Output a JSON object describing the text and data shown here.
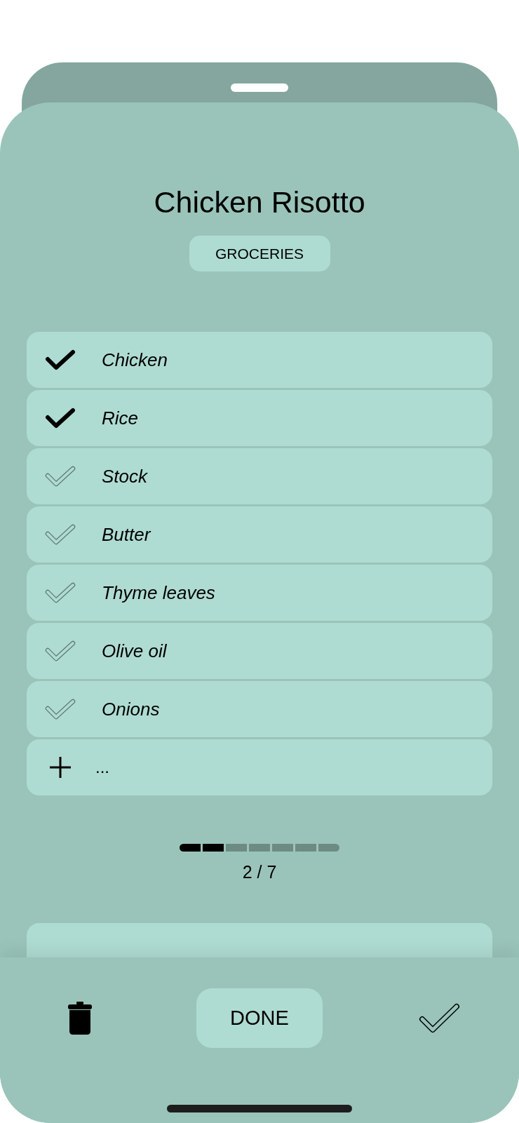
{
  "sheet": {
    "title": "Chicken Risotto",
    "category": "GROCERIES"
  },
  "items": [
    {
      "label": "Chicken",
      "checked": true
    },
    {
      "label": "Rice",
      "checked": true
    },
    {
      "label": "Stock",
      "checked": false
    },
    {
      "label": "Butter",
      "checked": false
    },
    {
      "label": "Thyme leaves",
      "checked": false
    },
    {
      "label": "Olive oil",
      "checked": false
    },
    {
      "label": "Onions",
      "checked": false
    }
  ],
  "add_item": {
    "placeholder": "..."
  },
  "progress": {
    "segments": [
      {
        "filled": true
      },
      {
        "filled": true
      },
      {
        "filled": false
      },
      {
        "filled": false
      },
      {
        "filled": false
      },
      {
        "filled": false
      },
      {
        "filled": false
      }
    ],
    "label": "2 / 7"
  },
  "toolbar": {
    "done_button": "DONE"
  }
}
